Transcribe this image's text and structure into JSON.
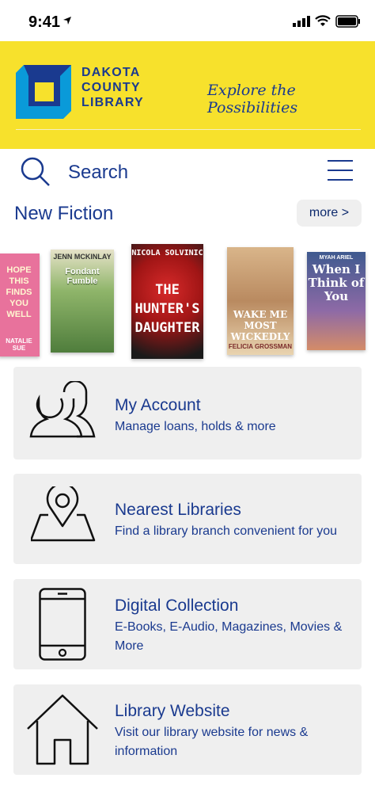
{
  "status": {
    "time": "9:41"
  },
  "header": {
    "logo_lines": [
      "DAKOTA",
      "COUNTY",
      "LIBRARY"
    ],
    "tagline": "Explore the Possibilities"
  },
  "search": {
    "label": "Search"
  },
  "new_fiction": {
    "title": "New Fiction",
    "more_label": "more >",
    "books": [
      {
        "cover_text": "HOPE THIS FINDS YOU WELL",
        "author": "NATALIE SUE",
        "color": "#e25a8f"
      },
      {
        "cover_text": "Fondant Fumble",
        "author": "JENN MCKINLAY",
        "color": "#4f7d3c"
      },
      {
        "cover_text": "THE HUNTER'S DAUGHTER",
        "author": "NICOLA SOLVINIC",
        "color": "#1a1a1a"
      },
      {
        "cover_text": "WAKE ME MOST WICKEDLY",
        "author": "FELICIA GROSSMAN",
        "color": "#c99a6a"
      },
      {
        "cover_text": "When I Think of You",
        "author": "MYAH ARIEL",
        "color": "#3f5a8f"
      }
    ]
  },
  "cards": [
    {
      "title": "My Account",
      "desc": "Manage loans, holds & more",
      "icon": "users-icon"
    },
    {
      "title": "Nearest Libraries",
      "desc": "Find a library branch convenient for you",
      "icon": "map-pin-icon"
    },
    {
      "title": "Digital Collection",
      "desc": "E-Books, E-Audio, Magazines, Movies & More",
      "icon": "phone-icon"
    },
    {
      "title": "Library Website",
      "desc": "Visit our library website for news & information",
      "icon": "home-icon"
    }
  ]
}
